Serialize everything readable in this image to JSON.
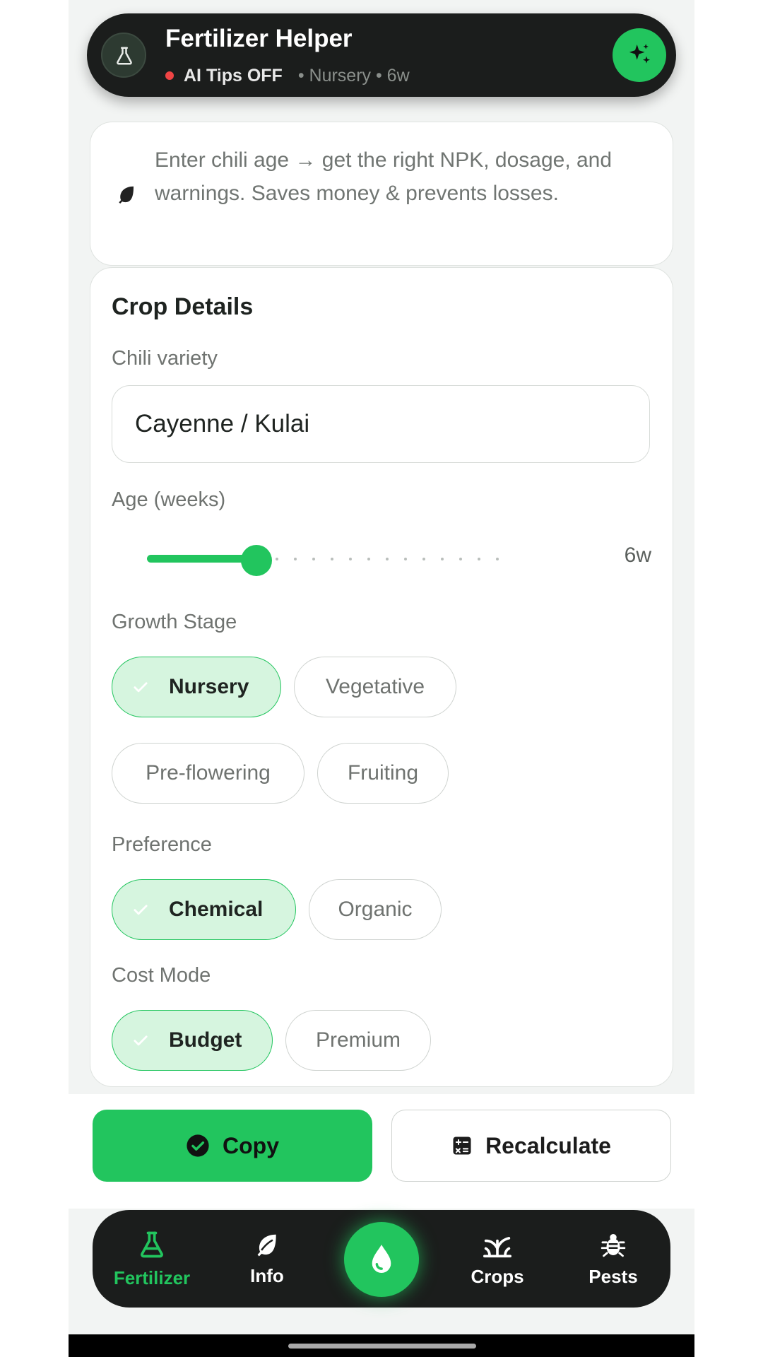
{
  "header": {
    "title": "Fertilizer Helper",
    "ai_status": "AI Tips OFF",
    "meta": "• Nursery • 6w"
  },
  "intro": {
    "text": "Enter chili age → get the right NPK, dosage, and warnings. Saves money & prevents losses."
  },
  "crop_details": {
    "title": "Crop Details",
    "variety_label": "Chili variety",
    "variety_value": "Cayenne / Kulai",
    "age_label": "Age (weeks)",
    "age_value": "6w",
    "age_weeks": 6,
    "age_max_weeks": 20,
    "growth_label": "Growth Stage",
    "growth_options": [
      "Nursery",
      "Vegetative",
      "Pre-flowering",
      "Fruiting"
    ],
    "growth_selected": "Nursery",
    "preference_label": "Preference",
    "preference_options": [
      "Chemical",
      "Organic"
    ],
    "preference_selected": "Chemical",
    "cost_label": "Cost Mode",
    "cost_options": [
      "Budget",
      "Premium"
    ],
    "cost_selected": "Budget"
  },
  "actions": {
    "copy_label": "Copy",
    "recalculate_label": "Recalculate"
  },
  "nav": {
    "items": [
      "Fertilizer",
      "Info",
      "Crops",
      "Pests"
    ],
    "active": "Fertilizer"
  },
  "colors": {
    "accent": "#22c55e",
    "dark": "#1b1d1c",
    "chip_selected_bg": "#d6f5df",
    "status_red": "#ef4444"
  },
  "icons": [
    "flask-icon",
    "sparkles-icon",
    "leaf-icon",
    "check-icon",
    "check-circle-icon",
    "calculator-icon",
    "water-drop-icon",
    "sprout-icon",
    "bug-icon"
  ]
}
